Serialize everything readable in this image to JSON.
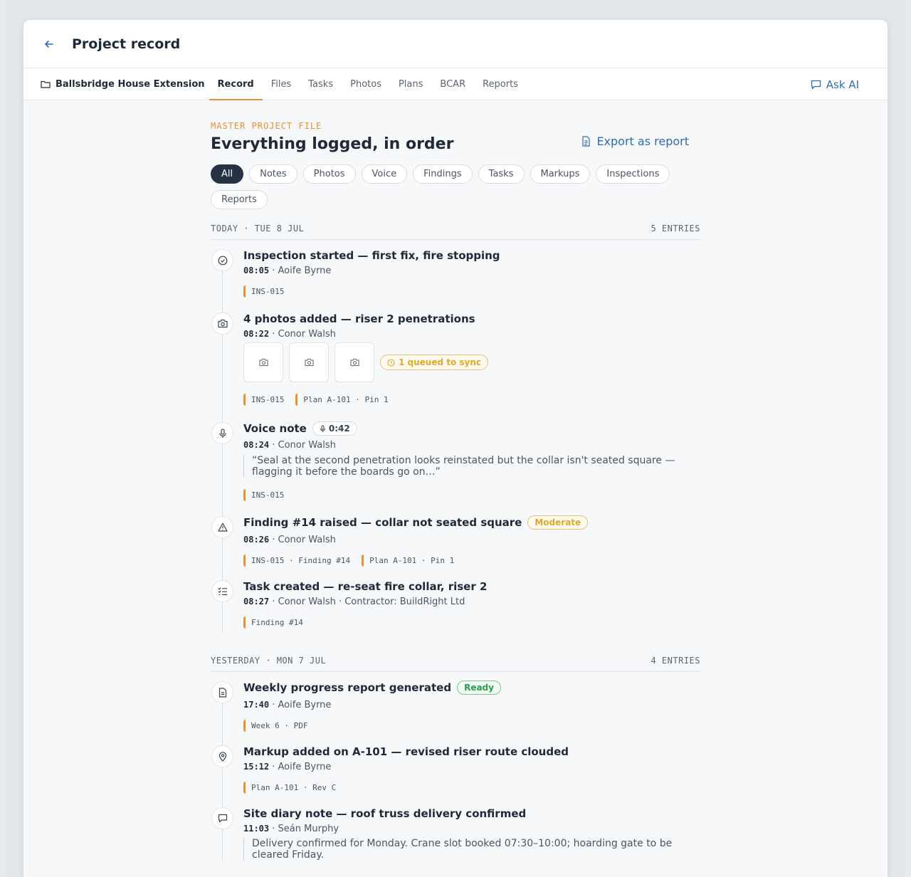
{
  "header": {
    "title": "Project record"
  },
  "nav": {
    "project": "Ballsbridge House Extension",
    "tabs": [
      "Record",
      "Files",
      "Tasks",
      "Photos",
      "Plans",
      "BCAR",
      "Reports"
    ],
    "ask_ai": "Ask AI"
  },
  "main": {
    "eyebrow": "MASTER PROJECT FILE",
    "headline": "Everything logged, in order",
    "export_label": "Export as report",
    "filters": [
      "All",
      "Notes",
      "Photos",
      "Voice",
      "Findings",
      "Tasks",
      "Markups",
      "Inspections",
      "Reports"
    ]
  },
  "days": [
    {
      "label": "TODAY · TUE 8 JUL",
      "count": "5 ENTRIES",
      "entries": [
        {
          "icon": "check-circle-icon",
          "title": "Inspection started — first fix, fire stopping",
          "time": "08:05",
          "meta": " · Aoife Byrne",
          "tags": [
            "INS-015"
          ]
        },
        {
          "icon": "camera-icon",
          "title": "4 photos added — riser 2 penetrations",
          "time": "08:22",
          "meta": " · Conor Walsh",
          "queued": "1 queued to sync",
          "tags": [
            "INS-015",
            "Plan A-101 · Pin 1"
          ]
        },
        {
          "icon": "microphone-icon",
          "title": "Voice note",
          "duration": "0:42",
          "time": "08:24",
          "meta": " · Conor Walsh",
          "quote": "“Seal at the second penetration looks reinstated but the collar isn't seated square — flagging it before the boards go on…”",
          "tags": [
            "INS-015"
          ]
        },
        {
          "icon": "warning-icon",
          "title": "Finding #14 raised — collar not seated square",
          "badge": "Moderate",
          "time": "08:26",
          "meta": " · Conor Walsh",
          "tags": [
            "INS-015 · Finding #14",
            "Plan A-101 · Pin 1"
          ]
        },
        {
          "icon": "checklist-icon",
          "title": "Task created — re-seat fire collar, riser 2",
          "time": "08:27",
          "meta": " · Conor Walsh · Contractor: BuildRight Ltd",
          "tags": [
            "Finding #14"
          ]
        }
      ]
    },
    {
      "label": "YESTERDAY · MON 7 JUL",
      "count": "4 ENTRIES",
      "entries": [
        {
          "icon": "document-icon",
          "title": "Weekly progress report generated",
          "badge": "Ready",
          "time": "17:40",
          "meta": " · Aoife Byrne",
          "tags": [
            "Week 6 · PDF"
          ]
        },
        {
          "icon": "map-pin-icon",
          "title": "Markup added on A-101 — revised riser route clouded",
          "time": "15:12",
          "meta": " · Aoife Byrne",
          "tags": [
            "Plan A-101 · Rev C"
          ]
        },
        {
          "icon": "speech-bubble-icon",
          "title": "Site diary note — roof truss delivery confirmed",
          "time": "11:03",
          "meta": " · Seán Murphy",
          "quote": "Delivery confirmed for Monday. Crane slot booked 07:30–10:00; hoarding gate to be cleared Friday.",
          "tags": []
        }
      ]
    }
  ]
}
